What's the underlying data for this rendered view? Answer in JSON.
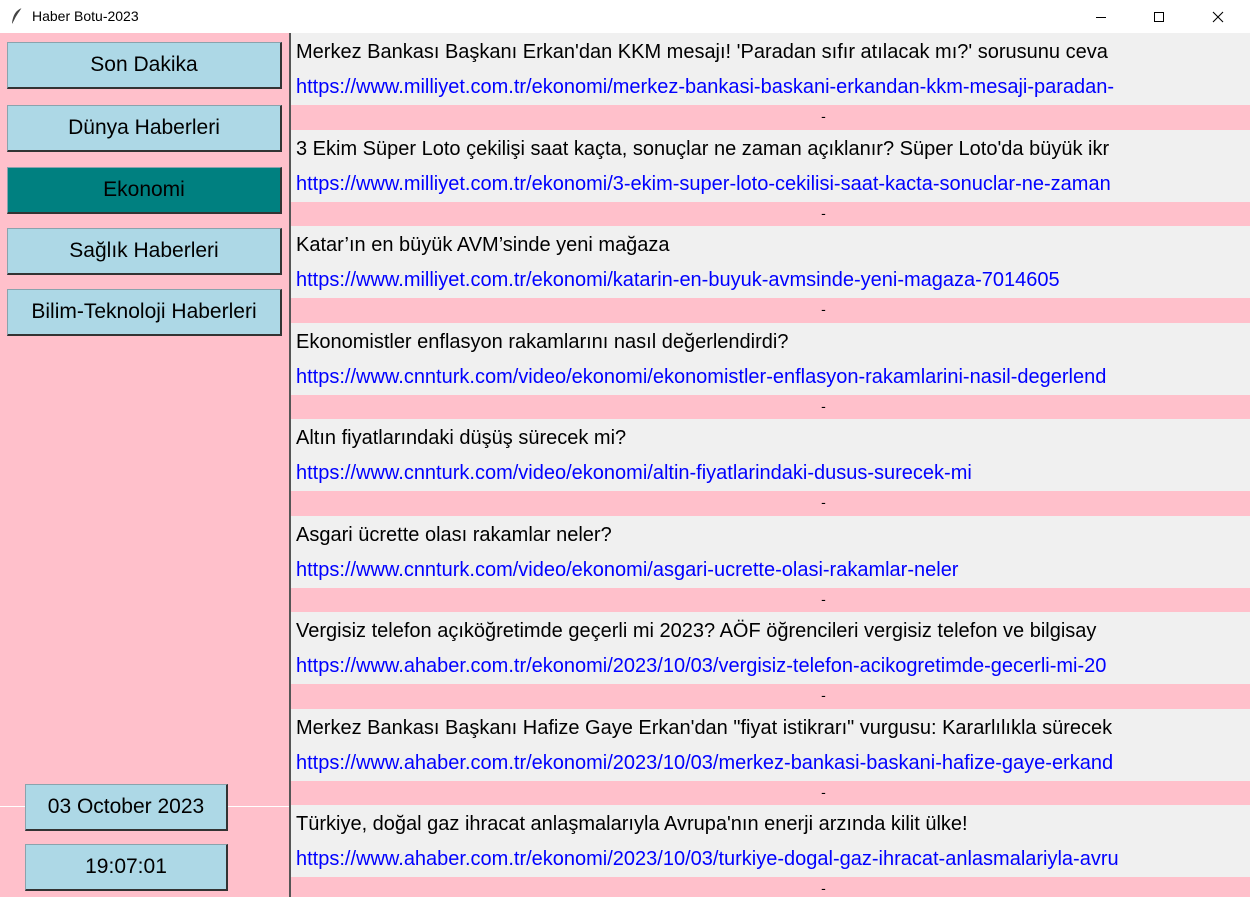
{
  "window": {
    "title": "Haber Botu-2023"
  },
  "sidebar": {
    "buttons": [
      {
        "label": "Son Dakika"
      },
      {
        "label": "Dünya Haberleri"
      },
      {
        "label": "Ekonomi"
      },
      {
        "label": "Sağlık Haberleri"
      },
      {
        "label": "Bilim-Teknoloji Haberleri"
      }
    ],
    "active": "Ekonomi",
    "date": "03 October 2023",
    "time": "19:07:01"
  },
  "colors": {
    "sidebar_bg": "#ffc0cb",
    "button_bg": "#add8e6",
    "active_bg": "#008080",
    "link": "#0000ff",
    "item_bg": "#f0f0f0"
  },
  "news": [
    {
      "title": "Merkez Bankası Başkanı Erkan'dan KKM mesajı! 'Paradan sıfır atılacak mı?' sorusunu ceva",
      "link": "https://www.milliyet.com.tr/ekonomi/merkez-bankasi-baskani-erkandan-kkm-mesaji-paradan-",
      "sep": "-"
    },
    {
      "title": "3 Ekim Süper Loto çekilişi saat kaçta, sonuçlar ne zaman açıklanır? Süper Loto'da büyük ikr",
      "link": "https://www.milliyet.com.tr/ekonomi/3-ekim-super-loto-cekilisi-saat-kacta-sonuclar-ne-zaman",
      "sep": "-"
    },
    {
      "title": "Katar’ın en büyük AVM’sinde yeni mağaza",
      "link": "https://www.milliyet.com.tr/ekonomi/katarin-en-buyuk-avmsinde-yeni-magaza-7014605",
      "sep": "-"
    },
    {
      "title": "Ekonomistler enflasyon rakamlarını nasıl değerlendirdi?",
      "link": "https://www.cnnturk.com/video/ekonomi/ekonomistler-enflasyon-rakamlarini-nasil-degerlend",
      "sep": "-"
    },
    {
      "title": "Altın fiyatlarındaki düşüş sürecek mi?",
      "link": "https://www.cnnturk.com/video/ekonomi/altin-fiyatlarindaki-dusus-surecek-mi",
      "sep": "-"
    },
    {
      "title": "Asgari ücrette olası rakamlar neler?",
      "link": "https://www.cnnturk.com/video/ekonomi/asgari-ucrette-olasi-rakamlar-neler",
      "sep": "-"
    },
    {
      "title": "Vergisiz telefon açıköğretimde geçerli mi 2023? AÖF öğrencileri vergisiz telefon ve bilgisay",
      "link": "https://www.ahaber.com.tr/ekonomi/2023/10/03/vergisiz-telefon-acikogretimde-gecerli-mi-20",
      "sep": "-"
    },
    {
      "title": "Merkez Bankası Başkanı Hafize Gaye Erkan'dan \"fiyat istikrarı\" vurgusu: Kararlılıkla sürecek",
      "link": "https://www.ahaber.com.tr/ekonomi/2023/10/03/merkez-bankasi-baskani-hafize-gaye-erkand",
      "sep": "-"
    },
    {
      "title": "Türkiye, doğal gaz ihracat anlaşmalarıyla Avrupa'nın enerji arzında kilit ülke!",
      "link": "https://www.ahaber.com.tr/ekonomi/2023/10/03/turkiye-dogal-gaz-ihracat-anlasmalariyla-avru",
      "sep": "-"
    }
  ]
}
